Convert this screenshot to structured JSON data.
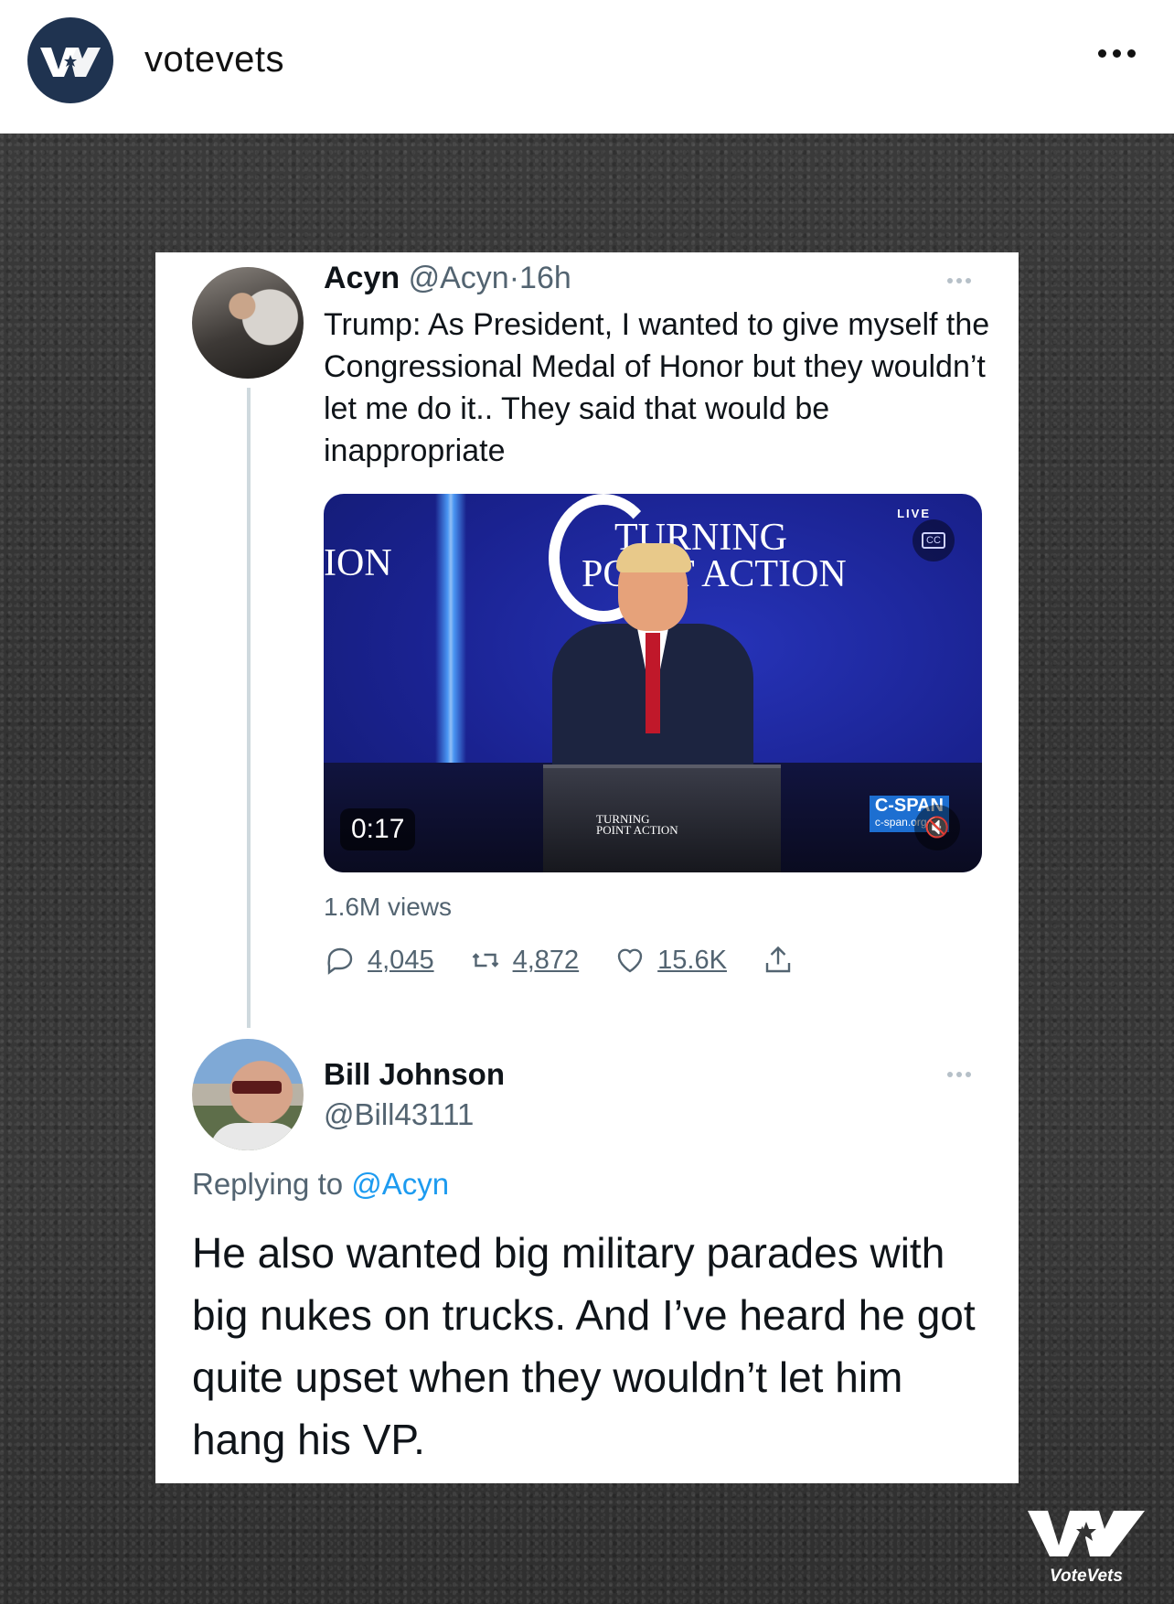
{
  "header": {
    "username": "votevets",
    "more_icon": "more-horizontal-icon"
  },
  "tweet": {
    "name": "Acyn",
    "handle": "@Acyn",
    "separator": "·",
    "time": "16h",
    "text": "Trump: As President, I wanted to give myself the Congressional Medal of Honor but they wouldn’t let me do it.. They said that would be inappropriate",
    "video": {
      "duration": "0:17",
      "live_label": "LIVE",
      "stage_text": "ION",
      "brand_line1": "TURNING",
      "brand_line2": "POINT ACTION",
      "podium_line1": "TURNING",
      "podium_line2": "POINT ACTION",
      "network": "C-SPAN",
      "network_sub": "c-span.org",
      "cc_label": "CC"
    },
    "views": "1.6M views",
    "stats": {
      "replies": "4,045",
      "retweets": "4,872",
      "likes": "15.6K"
    }
  },
  "reply": {
    "name": "Bill Johnson",
    "handle": "@Bill43111",
    "replying_prefix": "Replying to",
    "replying_to": "@Acyn",
    "text": "He also wanted big military parades with big nukes on trucks. And I’ve heard he got quite upset when they wouldn’t let him hang his VP."
  },
  "watermark": {
    "text": "VoteVets"
  },
  "colors": {
    "accent": "#1d9bf0",
    "secondary_text": "#536471",
    "brand_navy": "#1f3350"
  }
}
